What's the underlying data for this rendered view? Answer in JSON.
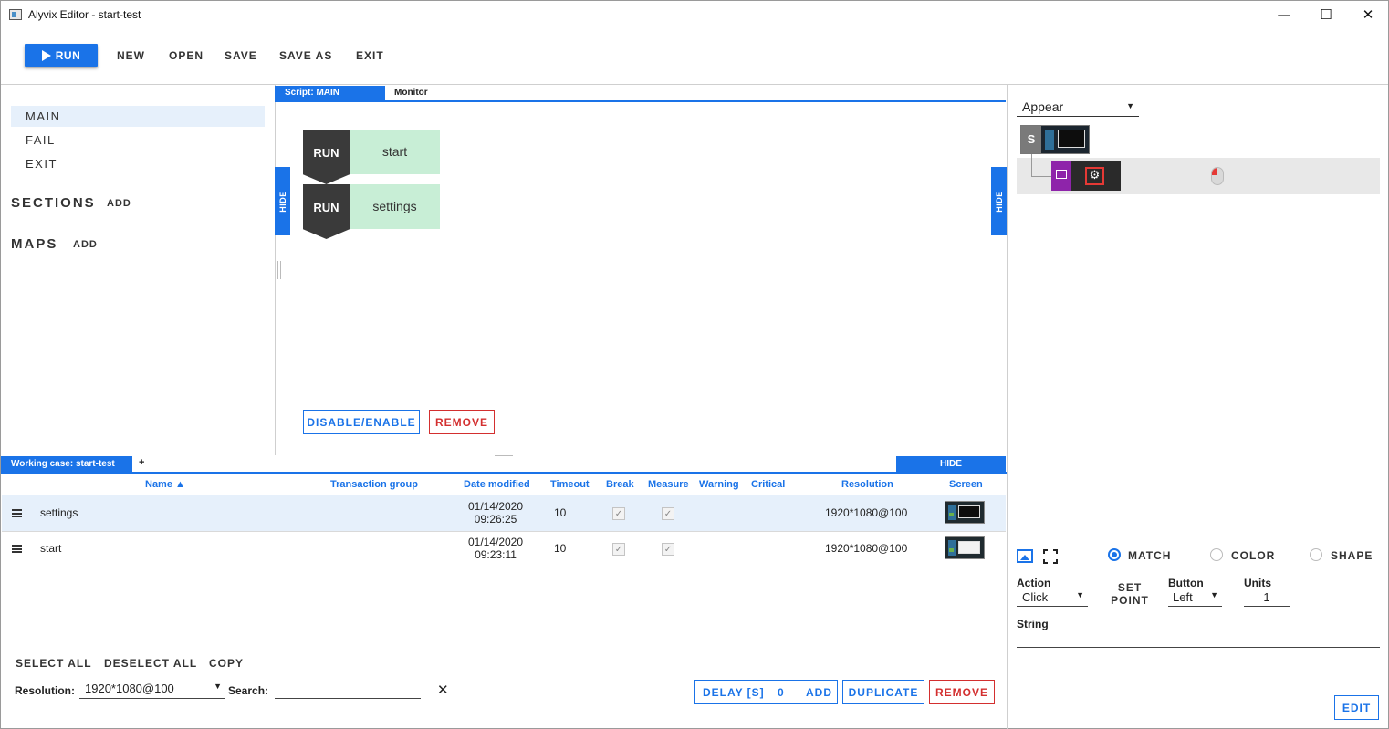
{
  "window": {
    "title": "Alyvix Editor - start-test",
    "minimize_glyph": "—",
    "maximize_glyph": "☐",
    "close_glyph": "✕"
  },
  "menu": {
    "run": "RUN",
    "new": "NEW",
    "open": "OPEN",
    "save": "SAVE",
    "save_as": "SAVE AS",
    "exit": "EXIT"
  },
  "nav": {
    "scripts": [
      "MAIN",
      "FAIL",
      "EXIT"
    ],
    "selected": "MAIN",
    "sections_label": "SECTIONS",
    "sections_add": "ADD",
    "maps_label": "MAPS",
    "maps_add": "ADD"
  },
  "script_panel": {
    "tabs": [
      "Script: MAIN",
      "Monitor"
    ],
    "hide_label": "HIDE",
    "steps": [
      {
        "action": "RUN",
        "name": "start"
      },
      {
        "action": "RUN",
        "name": "settings"
      }
    ],
    "disable_enable": "DISABLE/ENABLE",
    "remove": "REMOVE"
  },
  "working_case": {
    "tab": "Working case: start-test",
    "add_tab": "+",
    "hide": "HIDE",
    "columns": [
      "Name ▲",
      "Transaction group",
      "Date modified",
      "Timeout",
      "Break",
      "Measure",
      "Warning",
      "Critical",
      "Resolution",
      "Screen"
    ],
    "rows": [
      {
        "name": "settings",
        "transaction_group": "",
        "date": "01/14/2020",
        "time": "09:26:25",
        "timeout": "10",
        "break": true,
        "measure": true,
        "warning": "",
        "critical": "",
        "resolution": "1920*1080@100",
        "selected": true
      },
      {
        "name": "start",
        "transaction_group": "",
        "date": "01/14/2020",
        "time": "09:23:11",
        "timeout": "10",
        "break": true,
        "measure": true,
        "warning": "",
        "critical": "",
        "resolution": "1920*1080@100",
        "selected": false
      }
    ],
    "select_all": "SELECT ALL",
    "deselect_all": "DESELECT ALL",
    "copy": "COPY",
    "resolution_label": "Resolution:",
    "resolution_value": "1920*1080@100",
    "search_label": "Search:",
    "search_value": "",
    "clear_glyph": "✕",
    "delay_label": "DELAY [S]",
    "delay_value": "0",
    "delay_add": "ADD",
    "duplicate": "DUPLICATE",
    "remove": "REMOVE"
  },
  "object_panel": {
    "appear_mode": "Appear",
    "root_badge": "S",
    "modes": [
      "MATCH",
      "COLOR",
      "SHAPE"
    ],
    "selected_mode": "MATCH",
    "action_label": "Action",
    "action_value": "Click",
    "set_point_1": "SET",
    "set_point_2": "POINT",
    "button_label": "Button",
    "button_value": "Left",
    "units_label": "Units",
    "units_value": "1",
    "string_label": "String",
    "string_value": "",
    "edit": "EDIT"
  },
  "colors": {
    "accent": "#1a73e8",
    "danger": "#d32f2f",
    "step_bg": "#c8eed6",
    "run_block": "#3a3a3a",
    "selection": "#e6f0fb",
    "node_purple": "#8e24aa"
  },
  "icons": [
    "play-icon",
    "hamburger-icon",
    "image-icon",
    "fullscreen-icon",
    "gear-icon",
    "mouse-icon",
    "close-icon"
  ]
}
